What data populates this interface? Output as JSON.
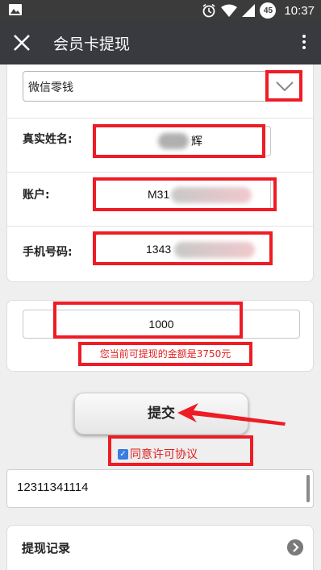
{
  "status_bar": {
    "time": "10:37",
    "battery_level": "45",
    "icons": [
      "image-icon",
      "alarm-icon",
      "wifi-icon",
      "signal-icon",
      "battery-icon"
    ]
  },
  "app_bar": {
    "title": "会员卡提现",
    "icons": [
      "close-icon",
      "more-vertical-icon"
    ]
  },
  "form": {
    "method": {
      "value": "微信零钱",
      "icon": "chevron-down-icon"
    },
    "name": {
      "label": "真实姓名:",
      "value": "辉"
    },
    "account": {
      "label": "账户:",
      "value": "M31"
    },
    "phone": {
      "label": "手机号码:",
      "value": "1343"
    }
  },
  "amount": {
    "value": "1000",
    "hint": "您当前可提现的金额是3750元"
  },
  "submit_label": "提交",
  "agree_label": "同意许可协议",
  "agree_checked": true,
  "textarea_value": "12311341114",
  "record": {
    "label": "提现记录",
    "icon": "chevron-right-circle-icon"
  },
  "colors": {
    "annotation_red": "#ee1c25",
    "app_bar": "#393a3f",
    "status_bar": "#3b3b3b",
    "hint_red": "#e02020"
  }
}
